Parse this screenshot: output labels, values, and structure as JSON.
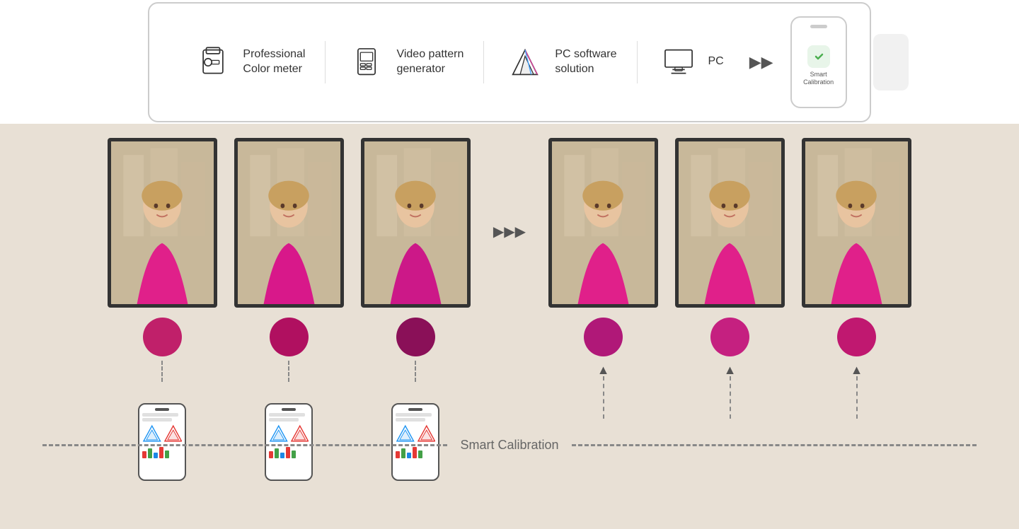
{
  "top": {
    "items": [
      {
        "id": "color-meter",
        "label": "Professional\nColor meter",
        "label_line1": "Professional",
        "label_line2": "Color meter"
      },
      {
        "id": "video-generator",
        "label": "Video pattern\ngenerator",
        "label_line1": "Video pattern",
        "label_line2": "generator"
      },
      {
        "id": "pc-software",
        "label": "PC software\nsolution",
        "label_line1": "PC software",
        "label_line2": "solution"
      },
      {
        "id": "pc",
        "label": "PC"
      }
    ],
    "phone_label_line1": "Smart",
    "phone_label_line2": "Calibration",
    "arrow": "▶▶"
  },
  "bottom": {
    "forward_arrows": "▶▶▶",
    "smart_calibration_label": "Smart Calibration",
    "tv_count_left": 3,
    "tv_count_right": 3,
    "color_dots": [
      "#c0206a",
      "#b01060",
      "#8a1058",
      "#b01878",
      "#c52080",
      "#c01870"
    ]
  }
}
